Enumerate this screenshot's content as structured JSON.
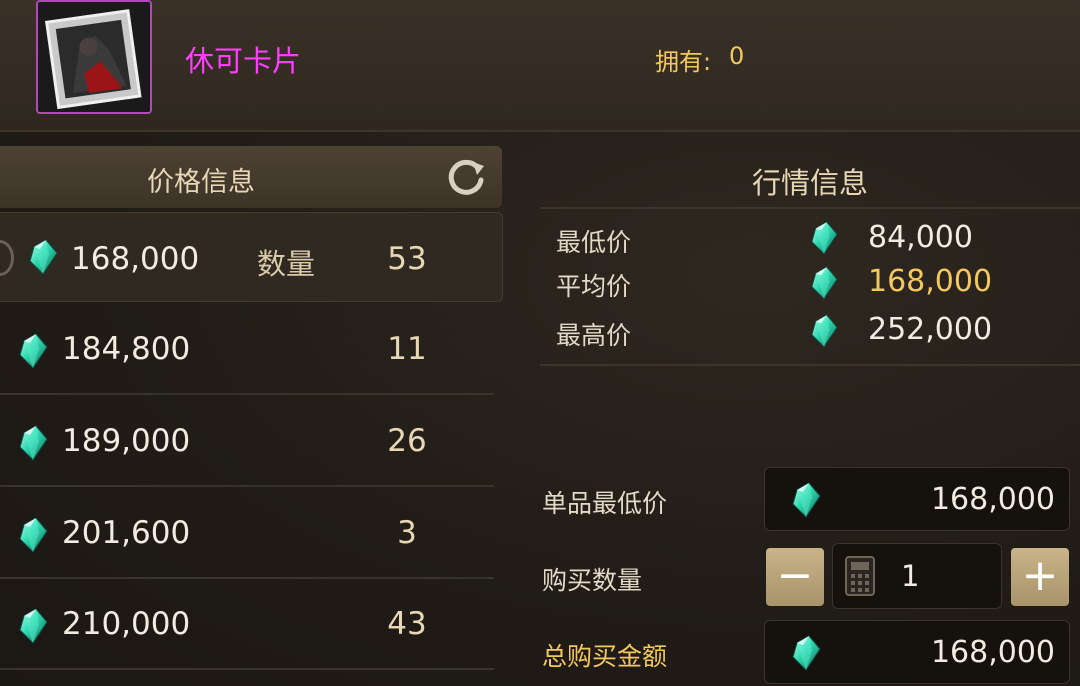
{
  "item": {
    "name": "休可卡片",
    "owned_label": "拥有:",
    "owned_count": "0",
    "icon": "card-icon",
    "name_color": "#ff3dff"
  },
  "price_info": {
    "title": "价格信息",
    "refresh_icon": "refresh-icon",
    "qty_label": "数量",
    "rows": [
      {
        "price": "168,000",
        "qty": "53"
      },
      {
        "price": "184,800",
        "qty": "11"
      },
      {
        "price": "189,000",
        "qty": "26"
      },
      {
        "price": "201,600",
        "qty": "3"
      },
      {
        "price": "210,000",
        "qty": "43"
      }
    ]
  },
  "market_info": {
    "title": "行情信息",
    "lowest_label": "最低价",
    "lowest_value": "84,000",
    "average_label": "平均价",
    "average_value": "168,000",
    "highest_label": "最高价",
    "highest_value": "252,000",
    "highlight_color": "#f3c85f"
  },
  "purchase": {
    "unit_min_label": "单品最低价",
    "unit_min_value": "168,000",
    "qty_label": "购买数量",
    "qty_value": "1",
    "minus": "−",
    "plus": "+",
    "total_label": "总购买金额",
    "total_value": "168,000"
  },
  "currency_icon": "gem-icon",
  "gem_color": "#2fd8b0"
}
